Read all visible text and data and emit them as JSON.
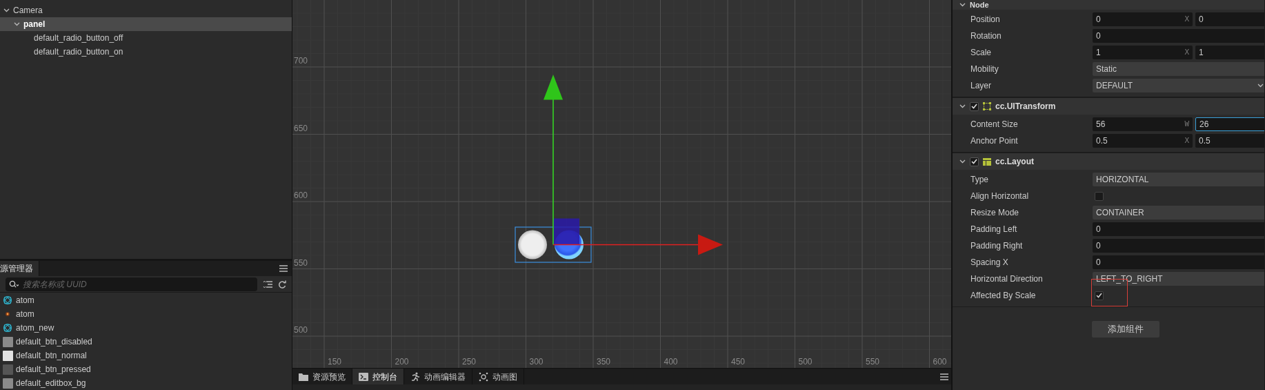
{
  "hierarchy": {
    "items": [
      {
        "label": "Camera",
        "expanded": true,
        "selected": false,
        "children": [
          {
            "label": "panel",
            "expanded": true,
            "selected": true,
            "children": [
              {
                "label": "default_radio_button_off",
                "selected": false
              },
              {
                "label": "default_radio_button_on",
                "selected": false
              }
            ]
          }
        ]
      }
    ]
  },
  "assets": {
    "tab": "源管理器",
    "search_placeholder": "搜索名称或 UUID",
    "items": [
      {
        "label": "atom",
        "kind": "prefab"
      },
      {
        "label": "atom",
        "kind": "particle"
      },
      {
        "label": "atom_new",
        "kind": "prefab"
      },
      {
        "label": "default_btn_disabled",
        "kind": "image",
        "color": "#8a8a8a"
      },
      {
        "label": "default_btn_normal",
        "kind": "image",
        "color": "#e2e2e2"
      },
      {
        "label": "default_btn_pressed",
        "kind": "image",
        "color": "#555555"
      },
      {
        "label": "default_editbox_bg",
        "kind": "image",
        "color": "#8a8a8a"
      }
    ]
  },
  "scene": {
    "x_labels": [
      "150",
      "200",
      "250",
      "300",
      "350",
      "400",
      "450",
      "500",
      "550",
      "600"
    ],
    "y_labels": [
      "700",
      "650",
      "600",
      "550",
      "500"
    ]
  },
  "bottom_tabs": [
    {
      "label": "资源预览",
      "selected": false
    },
    {
      "label": "控制台",
      "selected": true
    },
    {
      "label": "动画编辑器",
      "selected": false
    },
    {
      "label": "动画图",
      "selected": false
    }
  ],
  "inspector": {
    "node_header": "Node",
    "sections": [
      {
        "rows": [
          {
            "kind": "vec2",
            "label": "Position",
            "axis": "X",
            "values": [
              {
                "text": "0",
                "focused": false
              },
              {
                "text": "0",
                "focused": false
              }
            ]
          },
          {
            "kind": "number",
            "label": "Rotation",
            "value": "0"
          },
          {
            "kind": "vec2",
            "label": "Scale",
            "axis": "X",
            "values": [
              {
                "text": "1",
                "focused": false
              },
              {
                "text": "1",
                "focused": false
              }
            ]
          },
          {
            "kind": "select",
            "label": "Mobility",
            "value": "Static",
            "caret": false
          },
          {
            "kind": "select",
            "label": "Layer",
            "value": "DEFAULT",
            "caret": true
          }
        ]
      },
      {
        "title": "cc.UITransform",
        "enabled": true,
        "expanded": true,
        "rows": [
          {
            "kind": "vec2",
            "label": "Content Size",
            "axis": "W",
            "values": [
              {
                "text": "56",
                "focused": false
              },
              {
                "text": "26",
                "focused": true
              }
            ]
          },
          {
            "kind": "vec2",
            "label": "Anchor Point",
            "axis": "X",
            "values": [
              {
                "text": "0.5",
                "focused": false
              },
              {
                "text": "0.5",
                "focused": false
              }
            ]
          }
        ]
      },
      {
        "title": "cc.Layout",
        "enabled": true,
        "expanded": true,
        "rows": [
          {
            "kind": "select",
            "label": "Type",
            "value": "HORIZONTAL",
            "caret": false
          },
          {
            "kind": "checkbox",
            "label": "Align Horizontal",
            "checked": false,
            "highlighted": false
          },
          {
            "kind": "select",
            "label": "Resize Mode",
            "value": "CONTAINER",
            "caret": false
          },
          {
            "kind": "number",
            "label": "Padding Left",
            "value": "0"
          },
          {
            "kind": "number",
            "label": "Padding Right",
            "value": "0"
          },
          {
            "kind": "number",
            "label": "Spacing X",
            "value": "0"
          },
          {
            "kind": "select",
            "label": "Horizontal Direction",
            "value": "LEFT_TO_RIGHT",
            "caret": false
          },
          {
            "kind": "checkbox",
            "label": "Affected By Scale",
            "checked": true,
            "highlighted": true
          }
        ]
      }
    ],
    "add_button": "添加组件"
  }
}
